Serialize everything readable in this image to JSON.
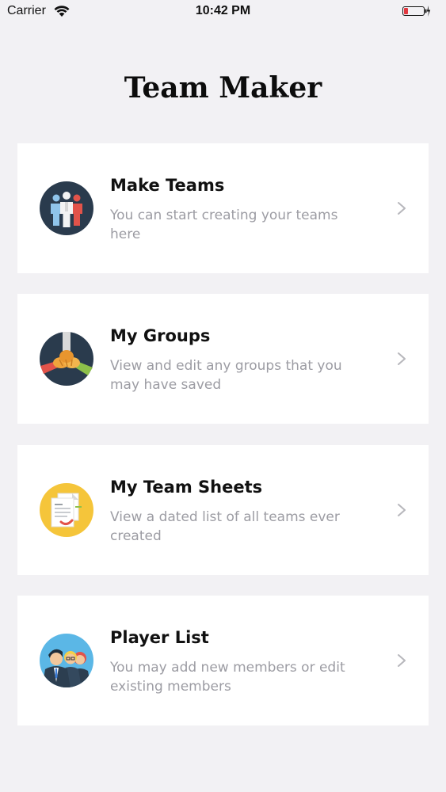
{
  "status_bar": {
    "carrier": "Carrier",
    "time": "10:42 PM"
  },
  "header": {
    "title": "Team Maker"
  },
  "menu": [
    {
      "title": "Make Teams",
      "description": "You can start creating your teams here",
      "icon": "team-people-icon"
    },
    {
      "title": "My Groups",
      "description": "View and edit any groups that you may have saved",
      "icon": "stacked-hands-icon"
    },
    {
      "title": "My Team Sheets",
      "description": "View a dated list of all teams ever created",
      "icon": "documents-icon"
    },
    {
      "title": "Player List",
      "description": "You may add new members or edit existing members",
      "icon": "players-avatars-icon"
    }
  ],
  "colors": {
    "background": "#f2f1f4",
    "card": "#ffffff",
    "description_text": "#9c9ca3",
    "chevron": "#b7b7bc",
    "battery_low": "#e2383f"
  }
}
